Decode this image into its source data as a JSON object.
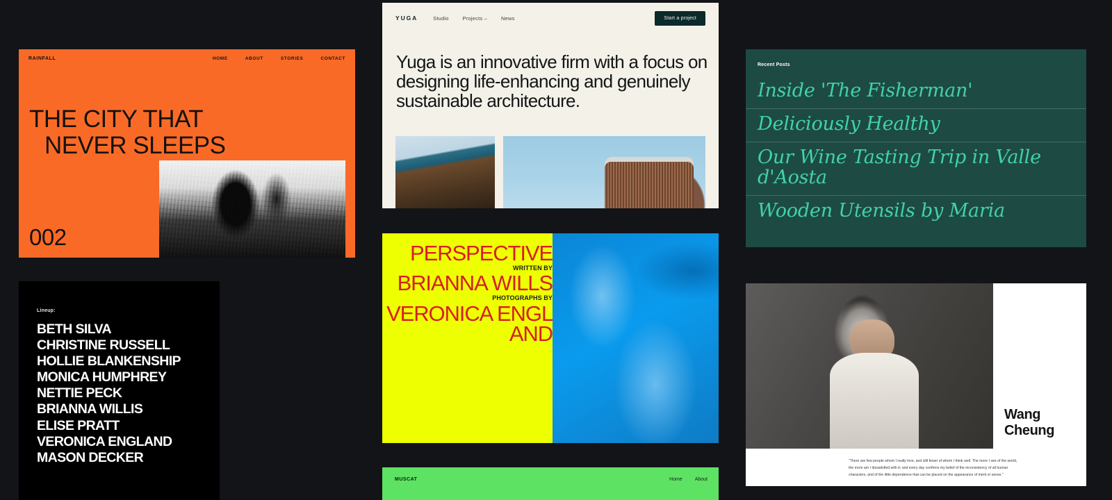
{
  "page": {
    "background": "#121417"
  },
  "rainfall": {
    "logo": "RAINFALL",
    "nav": [
      "HOME",
      "ABOUT",
      "STORIES",
      "CONTACT"
    ],
    "headline_line1": "THE CITY THAT",
    "headline_line2": "NEVER SLEEPS",
    "number": "002",
    "bg": "#FA6A27",
    "photo_alt": "rainy-street-photo"
  },
  "lineup": {
    "label": "Lineup:",
    "names": [
      "BETH SILVA",
      "CHRISTINE RUSSELL",
      "HOLLIE BLANKENSHIP",
      "MONICA HUMPHREY",
      "NETTIE PECK",
      "BRIANNA WILLIS",
      "ELISE PRATT",
      "VERONICA ENGLAND",
      "MASON DECKER"
    ],
    "bg": "#000000"
  },
  "yuga": {
    "logo": "YUGA",
    "nav": [
      "Studio",
      "Projects –",
      "News"
    ],
    "cta": "Start a project",
    "headline": "Yuga is an innovative firm with a focus on designing life-enhancing and genuinely sustainable architecture.",
    "bg": "#F4F1E8",
    "cta_bg": "#0C2A2B",
    "image_a_alt": "museum-roof-photo",
    "image_b_alt": "timber-tower-photo"
  },
  "perspective": {
    "title": "PERSPECTIVE",
    "written_by_label": "WRITTEN BY",
    "author": "BRIANNA WILLS",
    "photographs_by_label": "PHOTOGRAPHS BY",
    "photographer": "VERONICA ENGLAND",
    "yellow": "#EDFF00",
    "red": "#D61F26",
    "blue": "#0093E9",
    "image_alt": "underwater-swimmer-photo"
  },
  "muscat": {
    "logo": "MUSCAT",
    "nav": [
      "Home",
      "About"
    ],
    "bg": "#5DE263"
  },
  "posts": {
    "label": "Recent Posts",
    "items": [
      "Inside 'The Fisherman'",
      "Deliciously Healthy",
      "Our Wine Tasting Trip in Valle d'Aosta",
      "Wooden Utensils by Maria"
    ],
    "bg": "#1E4A44",
    "accent": "#41D2A8"
  },
  "wang": {
    "name_line1": "Wang",
    "name_line2": "Cheung",
    "quote": "“There are few people whom I really love, and still fewer of whom I think well. The more I see of the world, the more am I dissatisfied with it; and every day confirms my belief of the inconsistency of all human characters, and of the little dependence that can be placed on the appearance of merit or sense.”",
    "bg": "#FFFFFF",
    "portrait_alt": "portrait-photo"
  }
}
